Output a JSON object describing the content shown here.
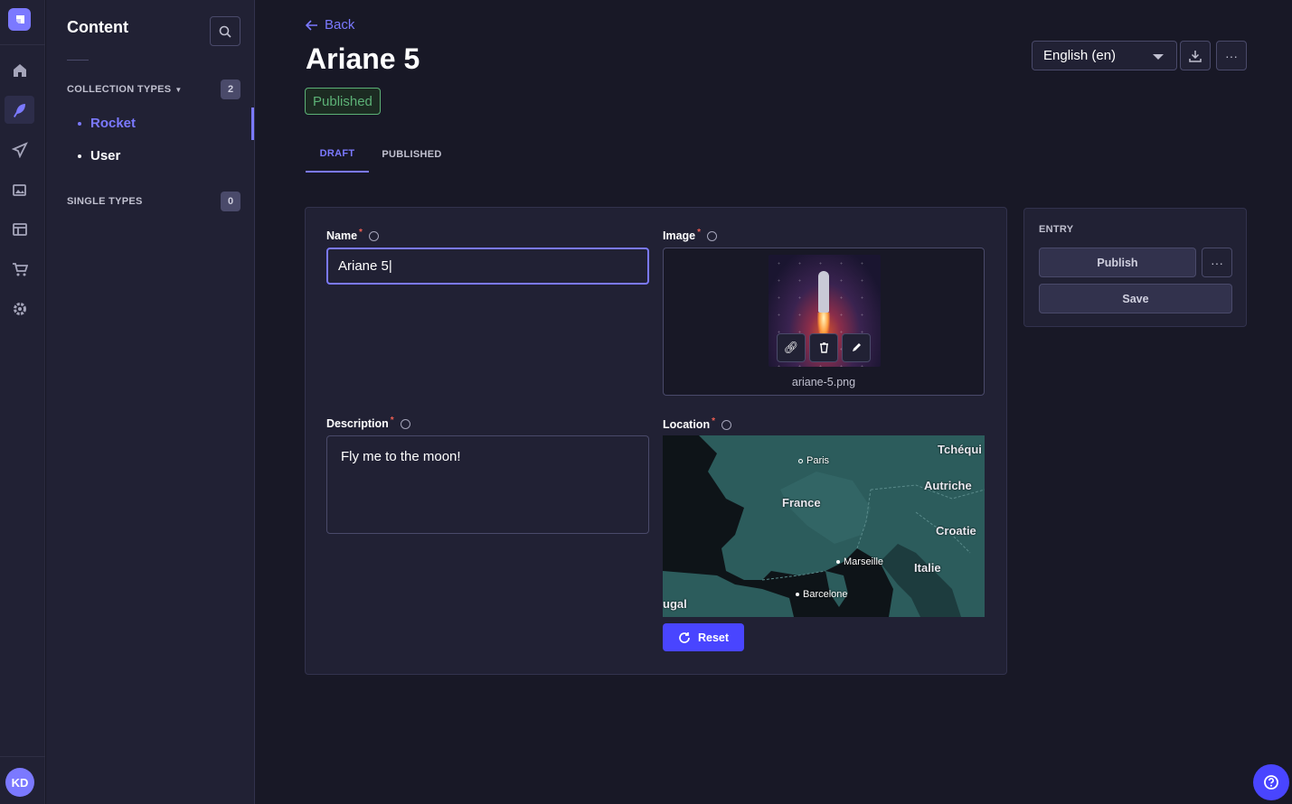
{
  "nav": {
    "items": [
      {
        "icon": "home-icon"
      },
      {
        "icon": "feather-icon"
      },
      {
        "icon": "paper-plane-icon"
      },
      {
        "icon": "images-icon"
      },
      {
        "icon": "layout-icon"
      },
      {
        "icon": "cart-icon"
      },
      {
        "icon": "gear-icon"
      }
    ],
    "active_index": 1,
    "avatar_initials": "KD"
  },
  "subnav": {
    "title": "Content",
    "collection_types_label": "COLLECTION TYPES",
    "collection_types_count": "2",
    "collection_items": [
      {
        "label": "Rocket"
      },
      {
        "label": "User"
      }
    ],
    "single_types_label": "SINGLE TYPES",
    "single_types_count": "0"
  },
  "header": {
    "back_label": "Back",
    "title": "Ariane 5",
    "status": "Published",
    "locale": "English (en)"
  },
  "tabs": [
    {
      "label": "DRAFT"
    },
    {
      "label": "PUBLISHED"
    }
  ],
  "form": {
    "name_label": "Name",
    "name_value": "Ariane 5|",
    "image_label": "Image",
    "image_filename": "ariane-5.png",
    "description_label": "Description",
    "description_value": "Fly me to the moon!",
    "location_label": "Location",
    "reset_label": "Reset",
    "map_labels": {
      "paris": "Paris",
      "tchequie": "Tchéqui",
      "france": "France",
      "autriche": "Autriche",
      "croatie": "Croatie",
      "marseille": "Marseille",
      "italie": "Italie",
      "barcelone": "Barcelone",
      "portugal": "ugal"
    }
  },
  "entry": {
    "title": "ENTRY",
    "publish_label": "Publish",
    "save_label": "Save"
  },
  "colors": {
    "primary": "#7b79ff",
    "button": "#4945ff",
    "success": "#5cb176",
    "required": "#ee5e52",
    "background": "#181826",
    "surface": "#212134"
  }
}
